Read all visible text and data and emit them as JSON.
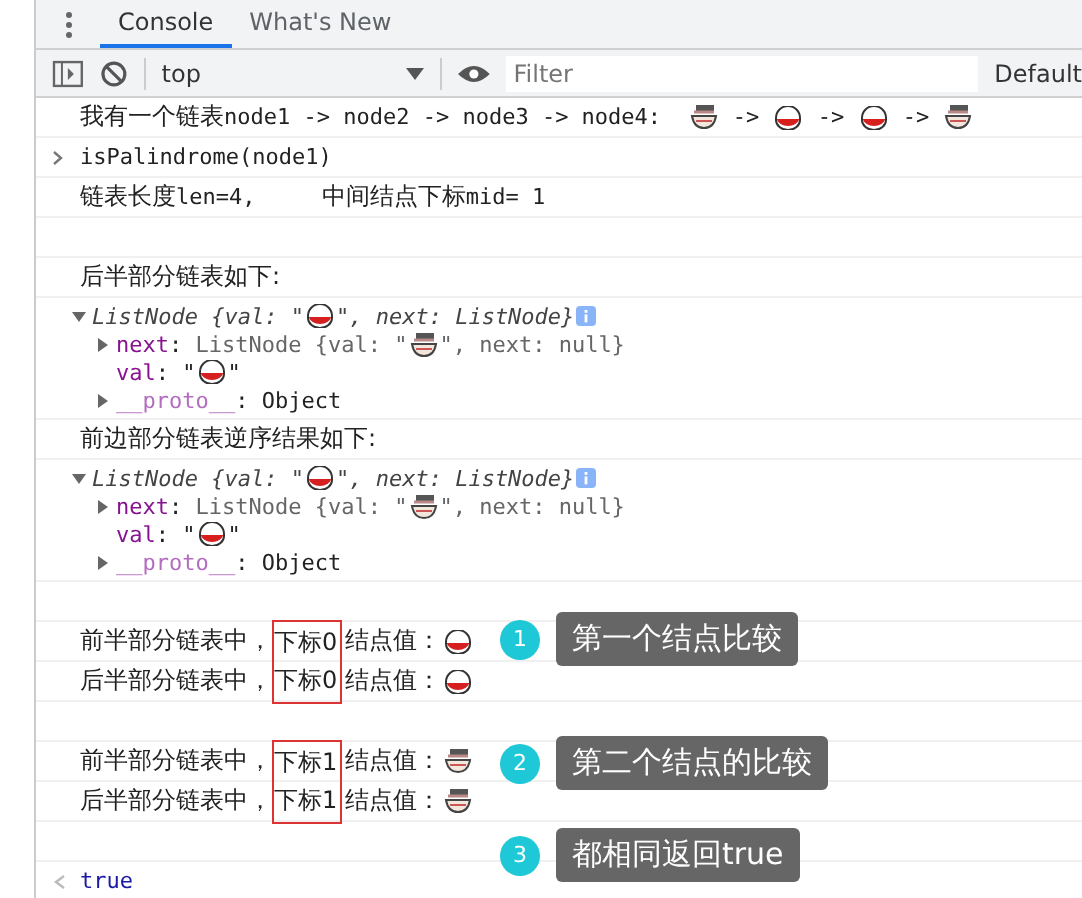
{
  "tabs": [
    {
      "label": "Console",
      "selected": true
    },
    {
      "label": "What's New",
      "selected": false
    }
  ],
  "toolbar": {
    "context": "top",
    "filter_placeholder": "Filter",
    "levels": "Default"
  },
  "rows": [
    {
      "kind": "log",
      "parts": [
        {
          "kind": "cn",
          "text": "我有一个链表"
        },
        {
          "kind": "code",
          "text": "node1 -> node2 -> node3 -> node4:  "
        },
        {
          "kind": "ramen"
        },
        {
          "kind": "code",
          "text": " -> "
        },
        {
          "kind": "bowl"
        },
        {
          "kind": "code",
          "text": " -> "
        },
        {
          "kind": "bowl"
        },
        {
          "kind": "code",
          "text": " -> "
        },
        {
          "kind": "ramen"
        }
      ]
    },
    {
      "kind": "input",
      "parts": [
        {
          "kind": "code",
          "text": "isPalindrome(node1)"
        }
      ]
    },
    {
      "kind": "log",
      "parts": [
        {
          "kind": "cn",
          "text": "链表长度"
        },
        {
          "kind": "code",
          "text": "len=4,     "
        },
        {
          "kind": "cn",
          "text": "中间结点下标"
        },
        {
          "kind": "code",
          "text": "mid= 1"
        }
      ]
    },
    {
      "kind": "blank"
    },
    {
      "kind": "log",
      "parts": [
        {
          "kind": "cn",
          "text": "后半部分链表如下:"
        }
      ]
    },
    {
      "kind": "object",
      "lines": [
        {
          "expanded": true,
          "parts": [
            {
              "kind": "italic",
              "text": "ListNode {val: \""
            },
            {
              "kind": "bowl"
            },
            {
              "kind": "italic",
              "text": "\", next: ListNode}"
            },
            {
              "kind": "info"
            }
          ]
        },
        {
          "expanded": false,
          "parts": [
            {
              "kind": "key",
              "text": "next"
            },
            {
              "kind": "code",
              "text": ": "
            },
            {
              "kind": "dim",
              "text": "ListNode {val: \""
            },
            {
              "kind": "ramen"
            },
            {
              "kind": "dim",
              "text": "\", next: null}"
            }
          ]
        },
        {
          "parts": [
            {
              "kind": "key",
              "text": "val"
            },
            {
              "kind": "code",
              "text": ": \""
            },
            {
              "kind": "bowl"
            },
            {
              "kind": "code",
              "text": "\""
            }
          ]
        },
        {
          "expanded": false,
          "parts": [
            {
              "kind": "key-dim",
              "text": "__proto__"
            },
            {
              "kind": "code",
              "text": ": Object"
            }
          ]
        }
      ]
    },
    {
      "kind": "log",
      "parts": [
        {
          "kind": "cn",
          "text": "前边部分链表逆序结果如下:"
        }
      ]
    },
    {
      "kind": "object",
      "lines": [
        {
          "expanded": true,
          "parts": [
            {
              "kind": "italic",
              "text": "ListNode {val: \""
            },
            {
              "kind": "bowl"
            },
            {
              "kind": "italic",
              "text": "\", next: ListNode}"
            },
            {
              "kind": "info"
            }
          ]
        },
        {
          "expanded": false,
          "parts": [
            {
              "kind": "key",
              "text": "next"
            },
            {
              "kind": "code",
              "text": ": "
            },
            {
              "kind": "dim",
              "text": "ListNode {val: \""
            },
            {
              "kind": "ramen"
            },
            {
              "kind": "dim",
              "text": "\", next: null}"
            }
          ]
        },
        {
          "parts": [
            {
              "kind": "key",
              "text": "val"
            },
            {
              "kind": "code",
              "text": ": \""
            },
            {
              "kind": "bowl"
            },
            {
              "kind": "code",
              "text": "\""
            }
          ]
        },
        {
          "expanded": false,
          "parts": [
            {
              "kind": "key-dim",
              "text": "__proto__"
            },
            {
              "kind": "code",
              "text": ": Object"
            }
          ]
        }
      ]
    },
    {
      "kind": "blank"
    },
    {
      "kind": "log",
      "parts": [
        {
          "kind": "cn",
          "text": "前半部分链表中，"
        },
        {
          "kind": "boxed",
          "text": "下标0"
        },
        {
          "kind": "cn",
          "text": "结点值："
        },
        {
          "kind": "bowl"
        }
      ]
    },
    {
      "kind": "log",
      "parts": [
        {
          "kind": "cn",
          "text": "后半部分链表中，"
        },
        {
          "kind": "boxed",
          "text": "下标0"
        },
        {
          "kind": "cn",
          "text": "结点值："
        },
        {
          "kind": "bowl"
        }
      ]
    },
    {
      "kind": "blank"
    },
    {
      "kind": "log",
      "parts": [
        {
          "kind": "cn",
          "text": "前半部分链表中，"
        },
        {
          "kind": "boxed",
          "text": "下标1"
        },
        {
          "kind": "cn",
          "text": "结点值："
        },
        {
          "kind": "ramen"
        }
      ]
    },
    {
      "kind": "log",
      "parts": [
        {
          "kind": "cn",
          "text": "后半部分链表中，"
        },
        {
          "kind": "boxed",
          "text": "下标1"
        },
        {
          "kind": "cn",
          "text": "结点值："
        },
        {
          "kind": "ramen"
        }
      ]
    },
    {
      "kind": "blank"
    },
    {
      "kind": "result",
      "parts": [
        {
          "kind": "value",
          "text": "true"
        }
      ]
    }
  ],
  "callouts": [
    {
      "number": "1",
      "text": "第一个结点比较"
    },
    {
      "number": "2",
      "text": "第二个结点的比较"
    },
    {
      "number": "3",
      "text": "都相同返回true"
    }
  ]
}
